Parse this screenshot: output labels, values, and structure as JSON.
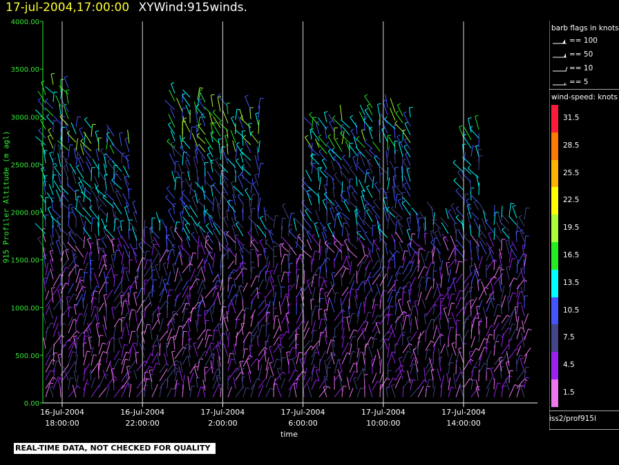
{
  "header": {
    "date": "17-jul-2004,17:00:00",
    "product": "XYWind:915winds."
  },
  "footer": {
    "qc_note": "REAL-TIME DATA, NOT CHECKED FOR QUALITY"
  },
  "legend": {
    "flags_title": "barb flags in knots",
    "flags": [
      {
        "label": "== 100",
        "knots": 100
      },
      {
        "label": "== 50",
        "knots": 50
      },
      {
        "label": "== 10",
        "knots": 10
      },
      {
        "label": "== 5",
        "knots": 5
      }
    ],
    "speed_title": "wind-speed: knots",
    "speed_bins": [
      {
        "label": "31.5",
        "color": "#ff1a3c"
      },
      {
        "label": "28.5",
        "color": "#ff7a00"
      },
      {
        "label": "25.5",
        "color": "#ffb300"
      },
      {
        "label": "22.5",
        "color": "#ffff00"
      },
      {
        "label": "19.5",
        "color": "#aaff33"
      },
      {
        "label": "16.5",
        "color": "#22ee22"
      },
      {
        "label": "13.5",
        "color": "#00ffff"
      },
      {
        "label": "10.5",
        "color": "#4455ff"
      },
      {
        "label": "7.5",
        "color": "#444488"
      },
      {
        "label": "4.5",
        "color": "#9922ee"
      },
      {
        "label": "1.5",
        "color": "#ee77ee"
      }
    ],
    "source": "iss2/prof915l"
  },
  "chart_data": {
    "type": "wind-barb",
    "xlabel": "time",
    "ylabel": "915 Profiler Altitude (m agl)",
    "ylim": [
      0,
      4000
    ],
    "yticks": [
      "0.00",
      "500.00",
      "1000.00",
      "1500.00",
      "2000.00",
      "2500.00",
      "3000.00",
      "3500.00",
      "4000.00"
    ],
    "xticks": [
      {
        "date": "16-Jul-2004",
        "time": "18:00:00"
      },
      {
        "date": "16-Jul-2004",
        "time": "22:00:00"
      },
      {
        "date": "17-Jul-2004",
        "time": "2:00:00"
      },
      {
        "date": "17-Jul-2004",
        "time": "6:00:00"
      },
      {
        "date": "17-Jul-2004",
        "time": "10:00:00"
      },
      {
        "date": "17-Jul-2004",
        "time": "14:00:00"
      }
    ],
    "grid": "vertical",
    "colors": {
      "axis": "#33ee33",
      "gridline": "#dddddd"
    }
  }
}
